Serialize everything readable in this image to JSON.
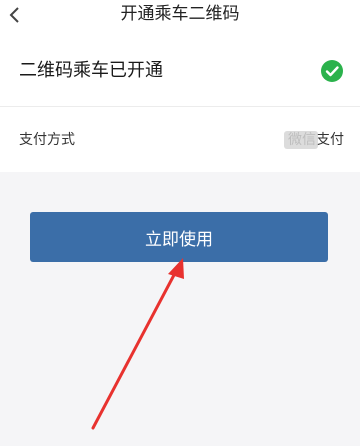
{
  "header": {
    "title": "开通乘车二维码",
    "back_icon": "chevron-left-icon"
  },
  "status": {
    "text": "二维码乘车已开通",
    "icon": "check-circle-icon",
    "icon_color": "#2bb24c"
  },
  "payment": {
    "label": "支付方式",
    "value": "微信支付"
  },
  "primary_button": {
    "label": "立即使用",
    "color": "#3b6ea8"
  },
  "annotation": {
    "arrow_color": "#e8322f"
  }
}
